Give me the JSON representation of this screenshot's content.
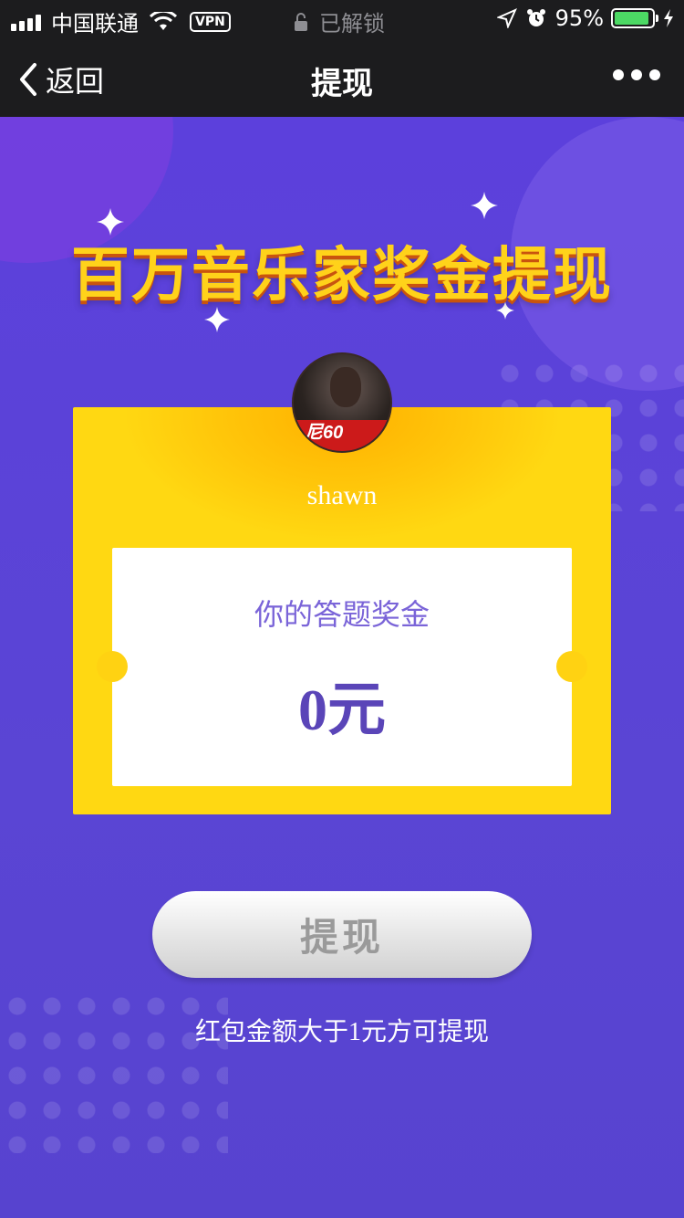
{
  "status_bar": {
    "carrier": "中国联通",
    "vpn": "VPN",
    "lock_text": "已解锁",
    "battery": "95%",
    "battery_level": 0.95
  },
  "nav": {
    "back_label": "返回",
    "title": "提现"
  },
  "main": {
    "headline": "百万音乐家奖金提现",
    "username": "shawn",
    "avatar_text": "尼60",
    "ticket_label": "你的答题奖金",
    "amount": "0元",
    "withdraw_button": "提现",
    "hint": "红包金额大于1元方可提现"
  },
  "colors": {
    "background": "#5a3fd6",
    "card": "#ffd212",
    "headline": "#ffd21a",
    "amount": "#5a45b8"
  }
}
